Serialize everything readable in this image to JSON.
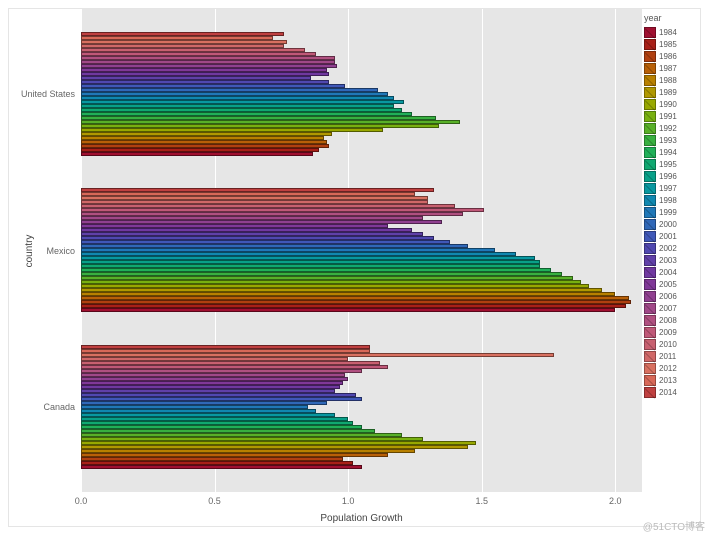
{
  "chart_data": {
    "type": "bar",
    "orientation": "horizontal",
    "title": "",
    "xlabel": "Population Growth",
    "ylabel": "country",
    "xlim": [
      0,
      2.1
    ],
    "xticks": [
      0.0,
      0.5,
      1.0,
      1.5,
      2.0
    ],
    "xtick_labels": [
      "0.0",
      "0.5",
      "1.0",
      "1.5",
      "2.0"
    ],
    "categories": [
      "United States",
      "Mexico",
      "Canada"
    ],
    "series_variable": "year",
    "series": [
      {
        "name": "1984",
        "color": "#a01030",
        "values": [
          0.87,
          2.0,
          1.05
        ]
      },
      {
        "name": "1985",
        "color": "#a82018",
        "values": [
          0.89,
          2.04,
          1.02
        ]
      },
      {
        "name": "1986",
        "color": "#b04010",
        "values": [
          0.93,
          2.06,
          0.98
        ]
      },
      {
        "name": "1987",
        "color": "#b86008",
        "values": [
          0.92,
          2.05,
          1.15
        ]
      },
      {
        "name": "1988",
        "color": "#b88000",
        "values": [
          0.91,
          2.0,
          1.25
        ]
      },
      {
        "name": "1989",
        "color": "#b09800",
        "values": [
          0.94,
          1.95,
          1.45
        ]
      },
      {
        "name": "1990",
        "color": "#98a800",
        "values": [
          1.13,
          1.9,
          1.48
        ]
      },
      {
        "name": "1991",
        "color": "#78b010",
        "values": [
          1.34,
          1.87,
          1.28
        ]
      },
      {
        "name": "1992",
        "color": "#58b028",
        "values": [
          1.42,
          1.84,
          1.2
        ]
      },
      {
        "name": "1993",
        "color": "#38b040",
        "values": [
          1.33,
          1.8,
          1.1
        ]
      },
      {
        "name": "1994",
        "color": "#20b058",
        "values": [
          1.24,
          1.76,
          1.05
        ]
      },
      {
        "name": "1995",
        "color": "#10a870",
        "values": [
          1.2,
          1.72,
          1.02
        ]
      },
      {
        "name": "1996",
        "color": "#08a088",
        "values": [
          1.17,
          1.72,
          1.0
        ]
      },
      {
        "name": "1997",
        "color": "#0898a0",
        "values": [
          1.21,
          1.7,
          0.95
        ]
      },
      {
        "name": "1998",
        "color": "#1088b0",
        "values": [
          1.17,
          1.63,
          0.88
        ]
      },
      {
        "name": "1999",
        "color": "#2078b8",
        "values": [
          1.15,
          1.55,
          0.85
        ]
      },
      {
        "name": "2000",
        "color": "#3068b8",
        "values": [
          1.11,
          1.45,
          0.92
        ]
      },
      {
        "name": "2001",
        "color": "#4058b8",
        "values": [
          0.99,
          1.38,
          1.05
        ]
      },
      {
        "name": "2002",
        "color": "#5048b0",
        "values": [
          0.93,
          1.32,
          1.03
        ]
      },
      {
        "name": "2003",
        "color": "#6040a8",
        "values": [
          0.86,
          1.28,
          0.95
        ]
      },
      {
        "name": "2004",
        "color": "#7038a0",
        "values": [
          0.93,
          1.24,
          0.97
        ]
      },
      {
        "name": "2005",
        "color": "#803898",
        "values": [
          0.92,
          1.15,
          0.98
        ]
      },
      {
        "name": "2006",
        "color": "#904090",
        "values": [
          0.96,
          1.35,
          1.0
        ]
      },
      {
        "name": "2007",
        "color": "#a04888",
        "values": [
          0.95,
          1.28,
          0.99
        ]
      },
      {
        "name": "2008",
        "color": "#b05080",
        "values": [
          0.95,
          1.43,
          1.05
        ]
      },
      {
        "name": "2009",
        "color": "#c05878",
        "values": [
          0.88,
          1.51,
          1.15
        ]
      },
      {
        "name": "2010",
        "color": "#c86070",
        "values": [
          0.84,
          1.4,
          1.12
        ]
      },
      {
        "name": "2011",
        "color": "#d06868",
        "values": [
          0.76,
          1.3,
          1.0
        ]
      },
      {
        "name": "2012",
        "color": "#d87060",
        "values": [
          0.77,
          1.3,
          1.77
        ]
      },
      {
        "name": "2013",
        "color": "#d86858",
        "values": [
          0.72,
          1.25,
          1.08
        ]
      },
      {
        "name": "2014",
        "color": "#c04040",
        "values": [
          0.76,
          1.32,
          1.08
        ]
      }
    ],
    "legend": {
      "title": "year",
      "position": "right"
    }
  },
  "watermark": "@51CTO博客"
}
